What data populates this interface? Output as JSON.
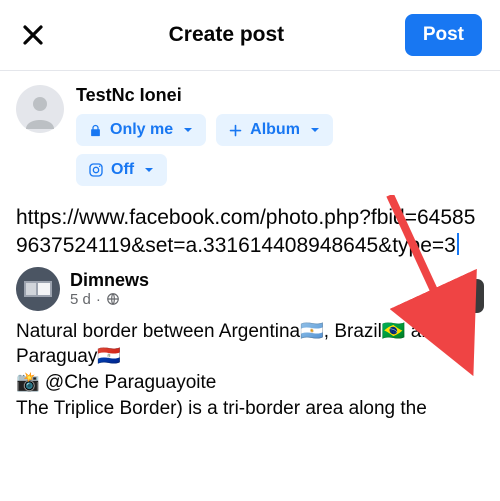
{
  "header": {
    "title": "Create post",
    "post_label": "Post"
  },
  "author": {
    "name": "TestNc Ionei",
    "audience_label": "Only me",
    "album_label": "Album",
    "instagram_label": "Off"
  },
  "composer": {
    "text": "https://www.facebook.com/photo.php?fbid=645859637524119&set=a.331614408948645&type=3"
  },
  "preview": {
    "source_name": "Dimnews",
    "age": "5 d",
    "body_line1": "Natural border between Argentina🇦🇷, Brazil🇧🇷 and Paraguay🇵🇾",
    "body_line2": "📸 @Che Paraguayoite",
    "body_line3": "The Triplice Border) is a tri-border area along the"
  }
}
